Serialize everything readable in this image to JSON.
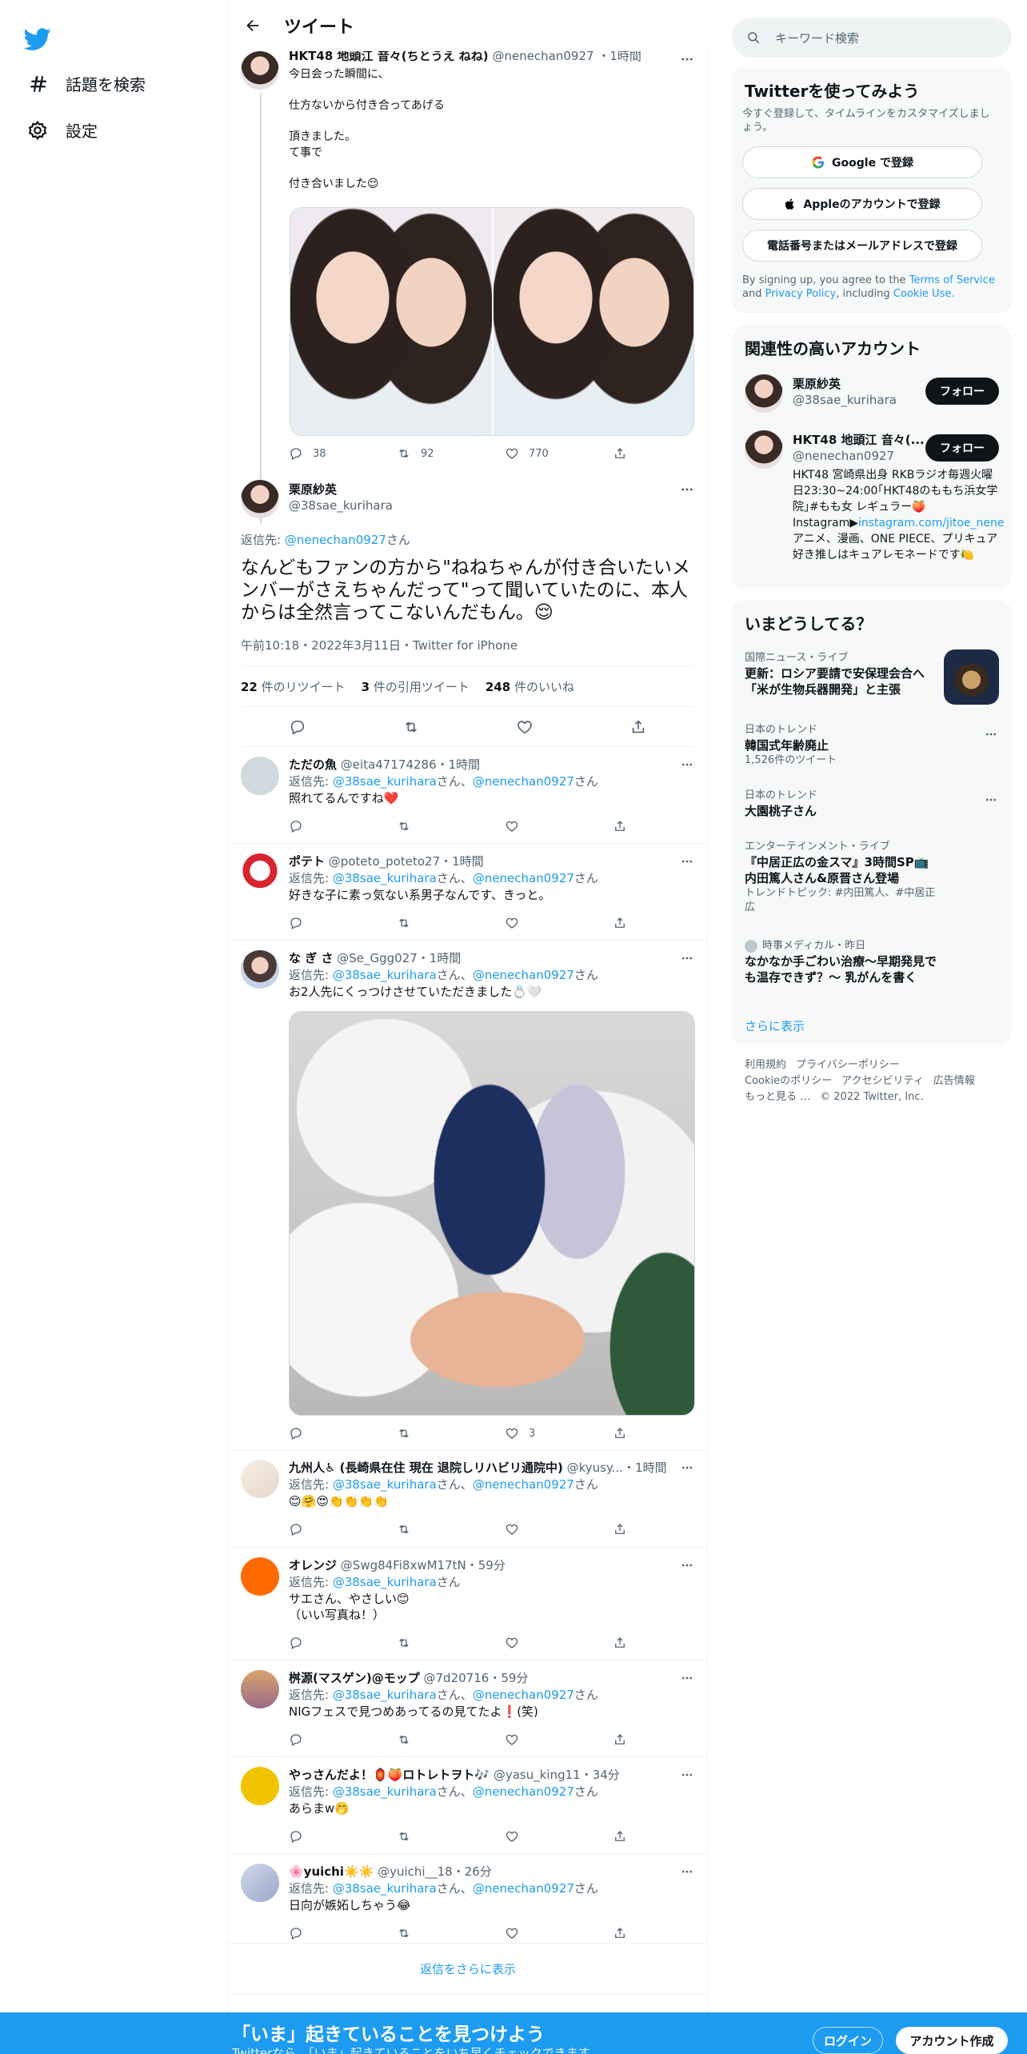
{
  "nav": {
    "explore": "話題を検索",
    "settings": "設定"
  },
  "header": {
    "title": "ツイート"
  },
  "parent": {
    "name": "HKT48 地頭江 音々(ちとうえ ねね)",
    "handle": "@nenechan0927",
    "time": "1時間",
    "text": "今日会った瞬間に、\n\n仕方ないから付き合ってあげる\n\n頂きました。\nて事で\n\n付き合いました😌",
    "replies": "38",
    "retweets": "92",
    "likes": "770"
  },
  "detail": {
    "name": "栗原紗英",
    "handle": "@38sae_kurihara",
    "reply_prefix": "返信先: ",
    "reply_to": "@nenechan0927",
    "reply_suffix": "さん",
    "text": "なんどもファンの方から\"ねねちゃんが付き合いたいメンバーがさえちゃんだって\"って聞いていたのに、本人からは全然言ってこないんだもん。😌",
    "meta": "午前10:18・2022年3月11日・Twitter for iPhone",
    "retweets": "22",
    "retweets_label": "件のリツイート",
    "quotes": "3",
    "quotes_label": "件の引用ツイート",
    "likes": "248",
    "likes_label": "件のいいね"
  },
  "replies": [
    {
      "name": "ただの魚",
      "handle": "@eita47174286",
      "time": "1時間",
      "to1": "@38sae_kurihara",
      "to2": "@nenechan0927",
      "text": "照れてるんですね❤️",
      "likes": ""
    },
    {
      "name": "ポテト",
      "handle": "@poteto_poteto27",
      "time": "1時間",
      "to1": "@38sae_kurihara",
      "to2": "@nenechan0927",
      "text": "好きな子に素っ気ない系男子なんです、きっと。",
      "likes": ""
    },
    {
      "name": "な ぎ さ",
      "handle": "@Se_Ggg027",
      "time": "1時間",
      "to1": "@38sae_kurihara",
      "to2": "@nenechan0927",
      "text": "お2人先にくっつけさせていただきました💍🤍",
      "likes": "3"
    },
    {
      "name": "九州人♿ (長崎県在住 現在 退院しリハビリ通院中)",
      "handle": "@kyusy...",
      "time": "1時間",
      "to1": "@38sae_kurihara",
      "to2": "@nenechan0927",
      "text": "😊🤗😍👏👏👏👏",
      "likes": ""
    },
    {
      "name": "オレンジ",
      "handle": "@Swg84Fi8xwM17tN",
      "time": "59分",
      "to1": "@38sae_kurihara",
      "to2": "",
      "text": "サエさん、やさしい😊\n（いい写真ね！）",
      "likes": ""
    },
    {
      "name": "桝源(マスゲン)@モップ",
      "handle": "@7d20716",
      "time": "59分",
      "to1": "@38sae_kurihara",
      "to2": "@nenechan0927",
      "text": "NIGフェスで見つめあってるの見てたよ❗️(笑)",
      "likes": ""
    },
    {
      "name": "やっさんだよ！🏮🍑ロトレトヲト🎶",
      "handle": "@yasu_king11",
      "time": "34分",
      "to1": "@38sae_kurihara",
      "to2": "@nenechan0927",
      "text": "あらまw🤭",
      "likes": ""
    },
    {
      "name": "🌸yuichi☀️☀️",
      "handle": "@yuichi__18",
      "time": "26分",
      "to1": "@38sae_kurihara",
      "to2": "@nenechan0927",
      "text": "日向が嫉妬しちゃう😂",
      "likes": ""
    }
  ],
  "common": {
    "reply_prefix": "返信先: ",
    "san": "さん",
    "and": "、"
  },
  "more_replies": "返信をさらに表示",
  "right": {
    "search_placeholder": "キーワード検索",
    "signup": {
      "title": "Twitterを使ってみよう",
      "desc": "今すぐ登録して、タイムラインをカスタマイズしましょう。",
      "google": "Google で登録",
      "apple": "Appleのアカウントで登録",
      "phone": "電話番号またはメールアドレスで登録",
      "terms_1": "By signing up, you agree to the ",
      "terms_link": "Terms of Service",
      "terms_2": " and ",
      "privacy_link": "Privacy Policy",
      "terms_3": ", including ",
      "cookie_link": "Cookie Use."
    },
    "related": {
      "title": "関連性の高いアカウント",
      "follow": "フォロー",
      "accounts": [
        {
          "name": "栗原紗英",
          "handle": "@38sae_kurihara",
          "bio": "",
          "link": ""
        },
        {
          "name": "HKT48 地頭江 音々(...",
          "handle": "@nenechan0927",
          "bio": "HKT48 宮崎県出身 RKBラジオ毎週火曜日23:30~24:00｢HKT48のももち浜女学院｣#もも女 レギュラー🍑 Instagram▶",
          "link": "instagram.com/jitoe_nene",
          "bio2": "アニメ、漫画、ONE PIECE、プリキュア好き推しはキュアレモネードです🍋"
        }
      ]
    },
    "trends": {
      "title": "いまどうしてる？",
      "items": [
        {
          "cat": "国際ニュース・ライブ",
          "t": "更新：ロシア要請で安保理会合へ 「米が生物兵器開発」と主張",
          "sub": ""
        },
        {
          "cat": "日本のトレンド",
          "t": "韓国式年齢廃止",
          "sub": "1,526件のツイート"
        },
        {
          "cat": "日本のトレンド",
          "t": "大園桃子さん",
          "sub": ""
        },
        {
          "cat": "エンターテインメント・ライブ",
          "t": "『中居正広の金スマ』3時間SP📺 内田篤人さん&原晋さん登場",
          "sub": "トレンドトピック: #内田篤人、#中居正広"
        },
        {
          "cat": "時事メディカル・昨日",
          "t": "なかなか手ごわい治療～早期発見でも温存できず？～ 乳がんを書く",
          "sub": ""
        }
      ],
      "show_more": "さらに表示"
    },
    "footer": [
      "利用規約",
      "プライバシーポリシー",
      "Cookieのポリシー",
      "アクセシビリティ",
      "広告情報",
      "もっと見る …",
      "© 2022 Twitter, Inc."
    ]
  },
  "banner": {
    "title": "「いま」起きていることを見つけよう",
    "subtitle": "Twitterなら、「いま」起きていることをいち早くチェックできます。",
    "login": "ログイン",
    "signup": "アカウント作成"
  },
  "colors": {
    "accent": "#1d9bf0",
    "text": "#0f1419",
    "muted": "#536471",
    "like_red": "#f91880"
  }
}
